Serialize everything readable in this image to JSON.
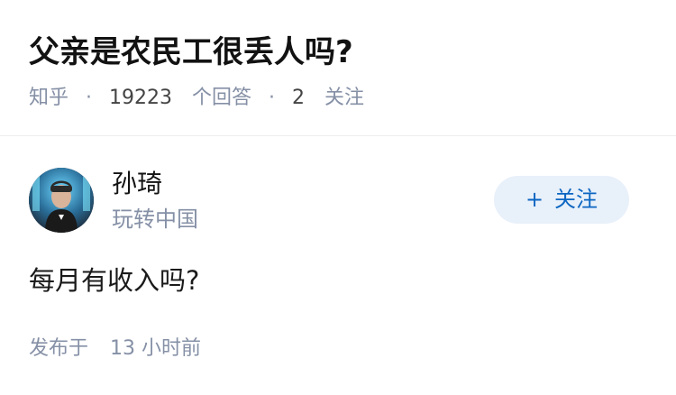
{
  "question": {
    "title": "父亲是农民工很丢人吗?",
    "source": "知乎",
    "answer_count": "19223",
    "answer_label": "个回答",
    "follower_count": "2",
    "follower_label": "关注"
  },
  "answer": {
    "author": {
      "name": "孙琦",
      "bio": "玩转中国",
      "follow_label": "关注",
      "follow_icon": "plus-icon",
      "avatar_icon": "person-photo"
    },
    "content": "每月有收入吗?",
    "publish_prefix": "发布于",
    "publish_time": "13 小时前"
  },
  "colors": {
    "meta_gray": "#8590a6",
    "follow_bg": "#e8f0fa",
    "follow_text": "#0b66c2"
  }
}
